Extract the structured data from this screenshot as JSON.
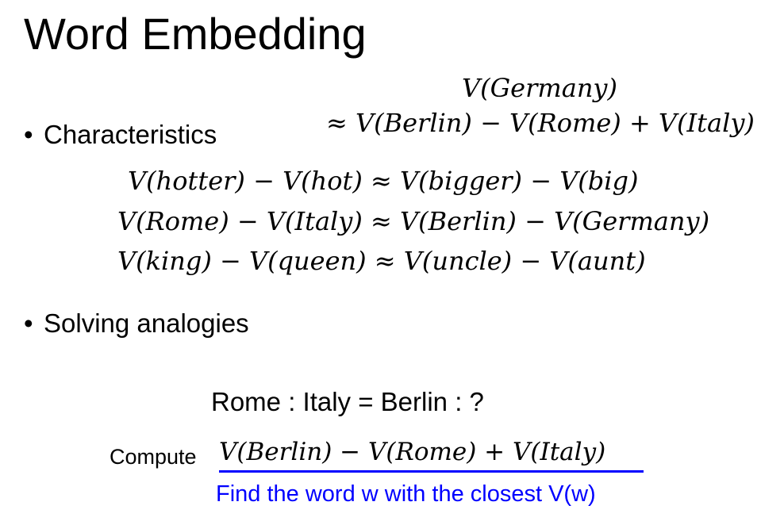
{
  "slide": {
    "title": "Word Embedding"
  },
  "bullets": {
    "characteristics": "Characteristics",
    "solving": "Solving analogies",
    "bullet_char": "•"
  },
  "top_equation": {
    "line1": "V(Germany)",
    "line2": "≈ V(Berlin) − V(Rome) + V(Italy)"
  },
  "equations": [
    "V(hotter) − V(hot) ≈ V(bigger) − V(big)",
    "V(Rome) − V(Italy) ≈ V(Berlin) − V(Germany)",
    "V(king) − V(queen) ≈ V(uncle) − V(aunt)"
  ],
  "analogy": {
    "text": "Rome : Italy = Berlin : ?"
  },
  "compute": {
    "label": "Compute",
    "expression": "V(Berlin) − V(Rome) + V(Italy)",
    "find_text": "Find the word w with the closest V(w)"
  },
  "colors": {
    "accent_blue": "#0000ff",
    "text": "#000000",
    "background": "#ffffff"
  }
}
